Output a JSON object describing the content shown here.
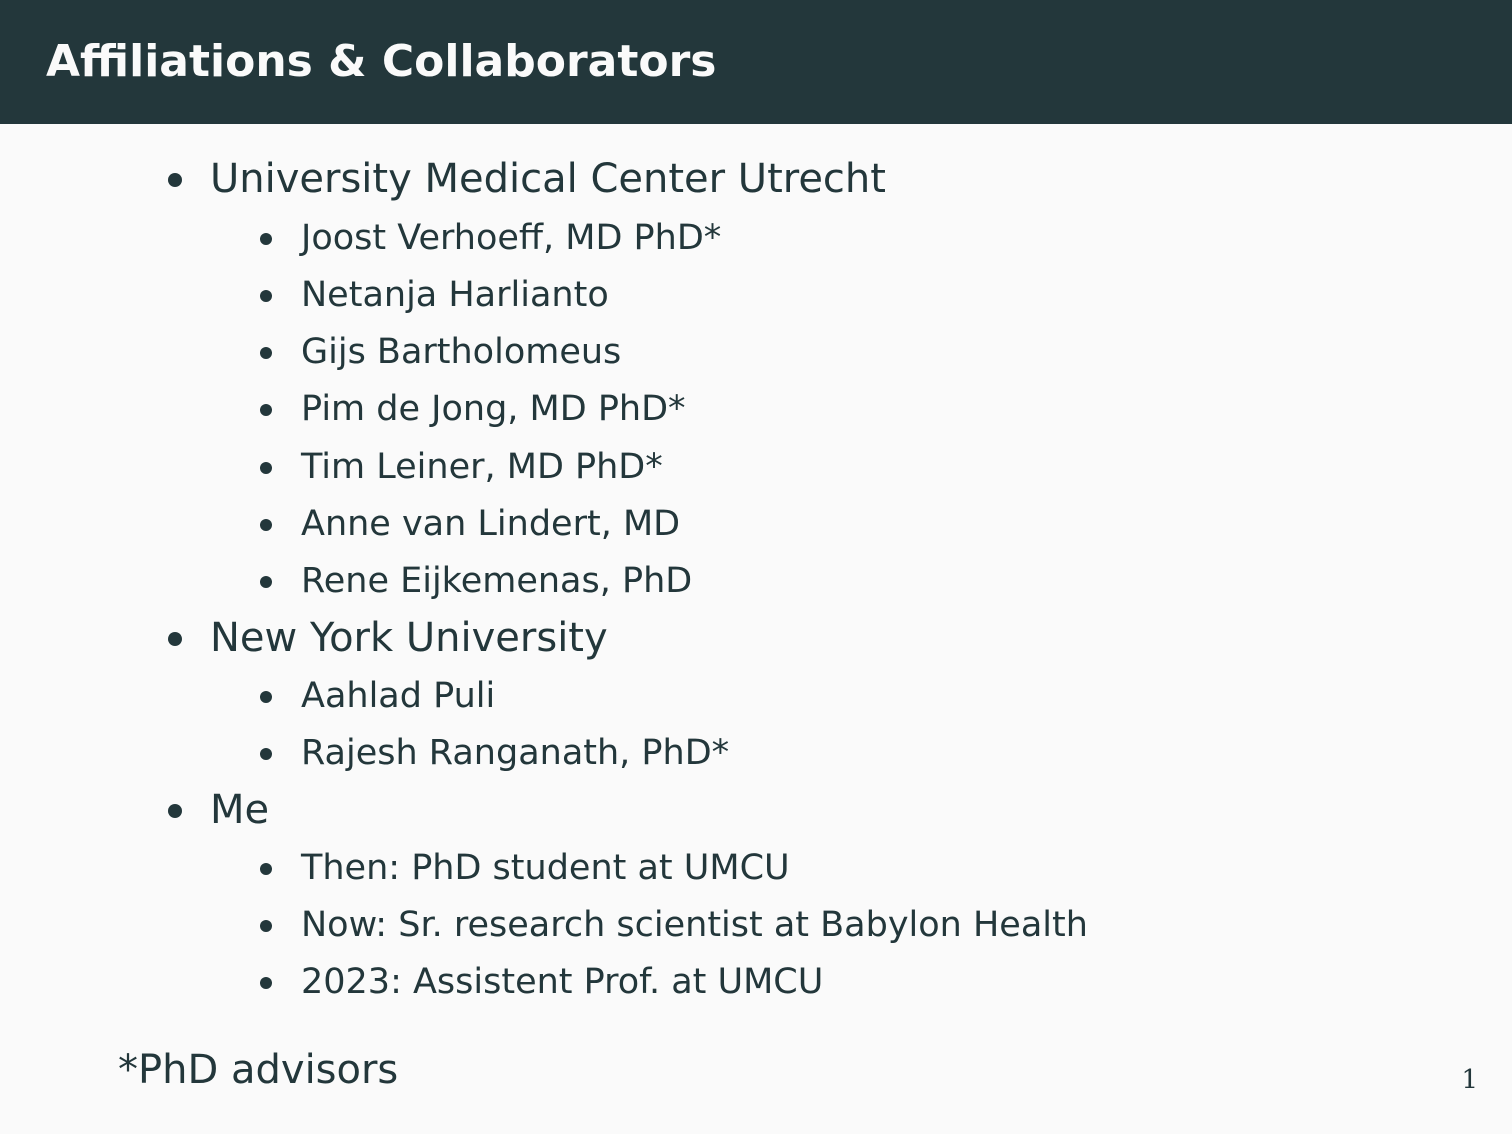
{
  "slide": {
    "title": "Affiliations & Collaborators",
    "groups": [
      {
        "label": "University Medical Center Utrecht",
        "items": [
          "Joost Verhoeff, MD PhD*",
          "Netanja Harlianto",
          "Gijs Bartholomeus",
          "Pim de Jong, MD PhD*",
          "Tim Leiner, MD PhD*",
          "Anne van Lindert, MD",
          "Rene Eijkemenas, PhD"
        ]
      },
      {
        "label": "New York University",
        "items": [
          "Aahlad Puli",
          "Rajesh Ranganath, PhD*"
        ]
      },
      {
        "label": "Me",
        "items": [
          "Then: PhD student at UMCU",
          "Now: Sr. research scientist at Babylon Health",
          "2023: Assistent Prof. at UMCU"
        ]
      }
    ],
    "footnote": "*PhD advisors",
    "page_number": "1"
  }
}
